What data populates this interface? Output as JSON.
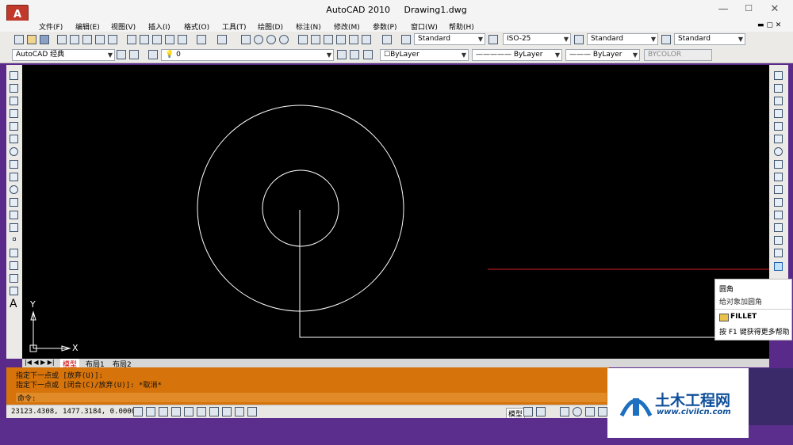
{
  "window": {
    "app_name": "AutoCAD 2010",
    "file_name": "Drawing1.dwg",
    "logo_letter": "A",
    "minimize": "—",
    "maximize": "☐",
    "close": "✕",
    "doc_controls": "▬ ▢ ✕"
  },
  "menu": [
    "文件(F)",
    "编辑(E)",
    "视图(V)",
    "插入(I)",
    "格式(O)",
    "工具(T)",
    "绘图(D)",
    "标注(N)",
    "修改(M)",
    "参数(P)",
    "窗口(W)",
    "帮助(H)"
  ],
  "toolbar1": {
    "text_style": "Standard",
    "dim_style": "ISO-25",
    "table_style": "Standard",
    "multileader_style": "Standard"
  },
  "toolbar2": {
    "workspace": "AutoCAD 经典",
    "layer": "0",
    "color": "ByLayer",
    "linetype": "ByLayer",
    "lineweight": "ByLayer",
    "plotstyle": "BYCOLOR"
  },
  "tooltip": {
    "title": "圆角",
    "description": "给对象加圆角",
    "command": "FILLET",
    "help": "按 F1 键获得更多帮助"
  },
  "ucs": {
    "y": "Y",
    "x": "X"
  },
  "tabs": [
    "模型",
    "布局1",
    "布局2"
  ],
  "command_lines": [
    "指定下一点或 [放弃(U)]:",
    "指定下一点或 [闭合(C)/放弃(U)]: *取消*",
    "命令:"
  ],
  "status": {
    "coords": "23123.4308, 1477.3184, 0.0000",
    "model_label": "模型"
  },
  "watermark": {
    "brand_text": "土木工程网",
    "url_text": "www.civilcn.com"
  }
}
